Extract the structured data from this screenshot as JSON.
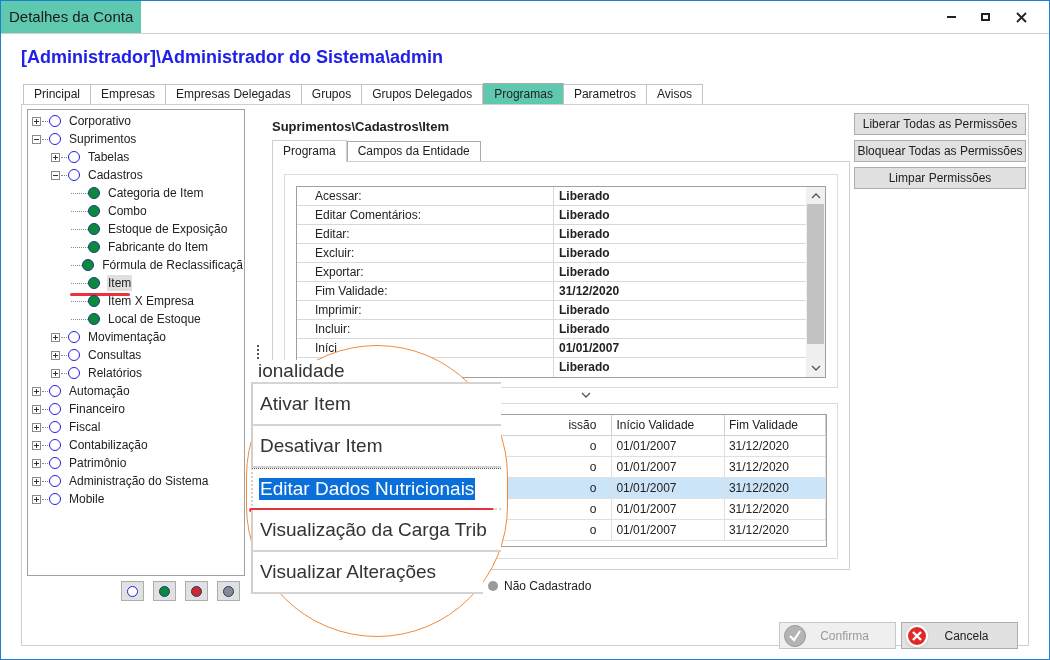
{
  "window": {
    "title": "Detalhes da Conta"
  },
  "heading": "[Administrador]\\Administrador do Sistema\\admin",
  "tabs": [
    {
      "label": "Principal",
      "selected": false
    },
    {
      "label": "Empresas",
      "selected": false
    },
    {
      "label": "Empresas Delegadas",
      "selected": false
    },
    {
      "label": "Grupos",
      "selected": false
    },
    {
      "label": "Grupos Delegados",
      "selected": false
    },
    {
      "label": "Programas",
      "selected": true
    },
    {
      "label": "Parametros",
      "selected": false
    },
    {
      "label": "Avisos",
      "selected": false
    }
  ],
  "tree": [
    {
      "label": "Corporativo",
      "kind": "empty",
      "expanded": false,
      "selected": false
    },
    {
      "label": "Suprimentos",
      "kind": "empty",
      "expanded": true,
      "selected": false,
      "children": [
        {
          "label": "Tabelas",
          "kind": "empty",
          "expanded": false,
          "selected": false
        },
        {
          "label": "Cadastros",
          "kind": "empty",
          "expanded": true,
          "selected": false,
          "children": [
            {
              "label": "Categoria de Item",
              "kind": "granted",
              "selected": false
            },
            {
              "label": "Combo",
              "kind": "granted",
              "selected": false
            },
            {
              "label": "Estoque de Exposição",
              "kind": "granted",
              "selected": false
            },
            {
              "label": "Fabricante do Item",
              "kind": "granted",
              "selected": false
            },
            {
              "label": "Fórmula de Reclassificaçã",
              "kind": "granted",
              "selected": false
            },
            {
              "label": "Item",
              "kind": "granted",
              "selected": true,
              "underlined": true
            },
            {
              "label": "Item X Empresa",
              "kind": "granted",
              "selected": false
            },
            {
              "label": "Local de Estoque",
              "kind": "granted",
              "selected": false
            }
          ]
        },
        {
          "label": "Movimentação",
          "kind": "empty",
          "expanded": false,
          "selected": false
        },
        {
          "label": "Consultas",
          "kind": "empty",
          "expanded": false,
          "selected": false
        },
        {
          "label": "Relatórios",
          "kind": "empty",
          "expanded": false,
          "selected": false
        }
      ]
    },
    {
      "label": "Automação",
      "kind": "empty",
      "expanded": false,
      "selected": false
    },
    {
      "label": "Financeiro",
      "kind": "empty",
      "expanded": false,
      "selected": false
    },
    {
      "label": "Fiscal",
      "kind": "empty",
      "expanded": false,
      "selected": false
    },
    {
      "label": "Contabilização",
      "kind": "empty",
      "expanded": false,
      "selected": false
    },
    {
      "label": "Patrimônio",
      "kind": "empty",
      "expanded": false,
      "selected": false
    },
    {
      "label": "Administração do Sistema",
      "kind": "empty",
      "expanded": false,
      "selected": false
    },
    {
      "label": "Mobile",
      "kind": "empty",
      "expanded": false,
      "selected": false
    }
  ],
  "filter_buttons": [
    {
      "kind": "empty"
    },
    {
      "kind": "granted"
    },
    {
      "kind": "blocked"
    },
    {
      "kind": "none"
    }
  ],
  "program_path": "Suprimentos\\Cadastros\\Item",
  "sub_tabs": [
    {
      "label": "Programa",
      "selected": true
    },
    {
      "label": "Campos da Entidade",
      "selected": false
    }
  ],
  "permissions": [
    {
      "label": "Acessar:",
      "value": "Liberado"
    },
    {
      "label": "Editar Comentários:",
      "value": "Liberado"
    },
    {
      "label": "Editar:",
      "value": "Liberado"
    },
    {
      "label": "Excluir:",
      "value": "Liberado"
    },
    {
      "label": "Exportar:",
      "value": "Liberado"
    },
    {
      "label": "Fim Validade:",
      "value": "31/12/2020"
    },
    {
      "label": "Imprimir:",
      "value": "Liberado"
    },
    {
      "label": "Incluir:",
      "value": "Liberado"
    },
    {
      "label": "Iníci",
      "value": "01/01/2007"
    },
    {
      "value": "Liberado"
    }
  ],
  "functions_table": {
    "columns": [
      "issão",
      "Início Validade",
      "Fim Validade"
    ],
    "rows": [
      {
        "cells": [
          "o",
          "01/01/2007",
          "31/12/2020"
        ],
        "selected": false
      },
      {
        "cells": [
          "o",
          "01/01/2007",
          "31/12/2020"
        ],
        "selected": false
      },
      {
        "cells": [
          "o",
          "01/01/2007",
          "31/12/2020"
        ],
        "selected": true
      },
      {
        "cells": [
          "o",
          "01/01/2007",
          "31/12/2020"
        ],
        "selected": false
      },
      {
        "cells": [
          "o",
          "01/01/2007",
          "31/12/2020"
        ],
        "selected": false
      }
    ]
  },
  "legend": [
    {
      "label": "Não Cadastrado",
      "color": "#9a9a9a"
    }
  ],
  "action_buttons": [
    {
      "label": "Liberar Todas as Permissões"
    },
    {
      "label": "Bloquear Todas as Permissões"
    },
    {
      "label": "Limpar Permissões"
    }
  ],
  "footer_buttons": [
    {
      "label": "Confirma",
      "kind": "confirm",
      "disabled": true
    },
    {
      "label": "Cancela",
      "kind": "cancel",
      "disabled": false
    }
  ],
  "magnifier": {
    "items": [
      {
        "label": "ionalidade",
        "selected": false,
        "underlined": false
      },
      {
        "label": "Ativar Item",
        "selected": false,
        "underlined": false
      },
      {
        "label": "Desativar Item",
        "selected": false,
        "underlined": false
      },
      {
        "label": "Editar Dados Nutricionais",
        "selected": true,
        "underlined": true
      },
      {
        "label": "Visualização da Carga Trib",
        "selected": false,
        "underlined": false
      },
      {
        "label": "Visualizar Alterações",
        "selected": false,
        "underlined": false
      }
    ]
  }
}
